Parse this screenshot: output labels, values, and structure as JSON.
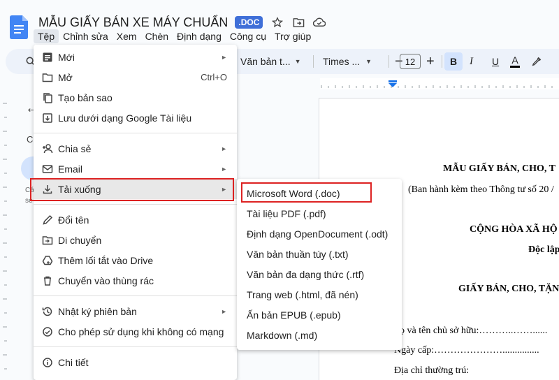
{
  "header": {
    "title": "MẪU GIẤY BÁN XE MÁY CHUẨN",
    "badge": ".DOC",
    "title_icons": [
      "star-icon",
      "move-folder-icon",
      "cloud-status-icon"
    ]
  },
  "menu_bar": [
    "Tệp",
    "Chỉnh sửa",
    "Xem",
    "Chèn",
    "Định dạng",
    "Công cụ",
    "Trợ giúp"
  ],
  "toolbar": {
    "style": "Văn bản t...",
    "font": "Times ...",
    "font_size": "12",
    "minus": "−",
    "plus": "+",
    "bold": "B",
    "text_color": "A"
  },
  "file_menu": {
    "items": [
      {
        "label": "Mới",
        "shortcut": "",
        "arrow": "►",
        "icon": "new-document-icon"
      },
      {
        "label": "Mở",
        "shortcut": "Ctrl+O",
        "arrow": "",
        "icon": "folder-open-icon"
      },
      {
        "label": "Tạo bản sao",
        "shortcut": "",
        "arrow": "",
        "icon": "copy-icon"
      },
      {
        "label": "Lưu dưới dạng Google Tài liệu",
        "shortcut": "",
        "arrow": "",
        "icon": "save-as-docs-icon"
      },
      {
        "label": "Chia sẻ",
        "shortcut": "",
        "arrow": "►",
        "icon": "share-person-icon"
      },
      {
        "label": "Email",
        "shortcut": "",
        "arrow": "►",
        "icon": "email-icon"
      },
      {
        "label": "Tải xuống",
        "shortcut": "",
        "arrow": "►",
        "icon": "download-icon"
      },
      {
        "label": "Đổi tên",
        "shortcut": "",
        "arrow": "",
        "icon": "pencil-icon"
      },
      {
        "label": "Di chuyển",
        "shortcut": "",
        "arrow": "",
        "icon": "move-folder-icon"
      },
      {
        "label": "Thêm lối tắt vào Drive",
        "shortcut": "",
        "arrow": "",
        "icon": "drive-shortcut-icon"
      },
      {
        "label": "Chuyển vào thùng rác",
        "shortcut": "",
        "arrow": "",
        "icon": "trash-icon"
      },
      {
        "label": "Nhật ký phiên bản",
        "shortcut": "",
        "arrow": "►",
        "icon": "history-icon"
      },
      {
        "label": "Cho phép sử dụng khi không có mạng",
        "shortcut": "",
        "arrow": "",
        "icon": "offline-icon"
      },
      {
        "label": "Chi tiết",
        "shortcut": "",
        "arrow": "",
        "icon": "info-icon"
      }
    ]
  },
  "download_submenu": {
    "items": [
      "Microsoft Word (.doc)",
      "Tài liệu PDF (.pdf)",
      "Định dạng OpenDocument (.odt)",
      "Văn bản thuần túy (.txt)",
      "Văn bản đa dạng thức (.rtf)",
      "Trang web (.html, đã nén)",
      "Ấn bản EPUB (.epub)",
      "Markdown (.md)"
    ]
  },
  "outline": {
    "c": "C",
    "ca": "Cá",
    "se": "se"
  },
  "document": {
    "lines": [
      "MẪU GIẤY BÁN, CHO, T",
      "(Ban hành kèm theo Thông tư số 20 /",
      "CỘNG HÒA XÃ HỘ",
      "Độc lập",
      "GIẤY BÁN, CHO, TẶN",
      "ọ và tên chủ sở hữu:………..……......",
      "Ngày cấp:…………………...............",
      "Địa chỉ thường trú:"
    ]
  },
  "colors": {
    "highlight_box": "#dd2222",
    "menu_hover": "#e8e8e8",
    "badge": "#3f6fd8",
    "toolbar_bg": "#edf2fa"
  }
}
